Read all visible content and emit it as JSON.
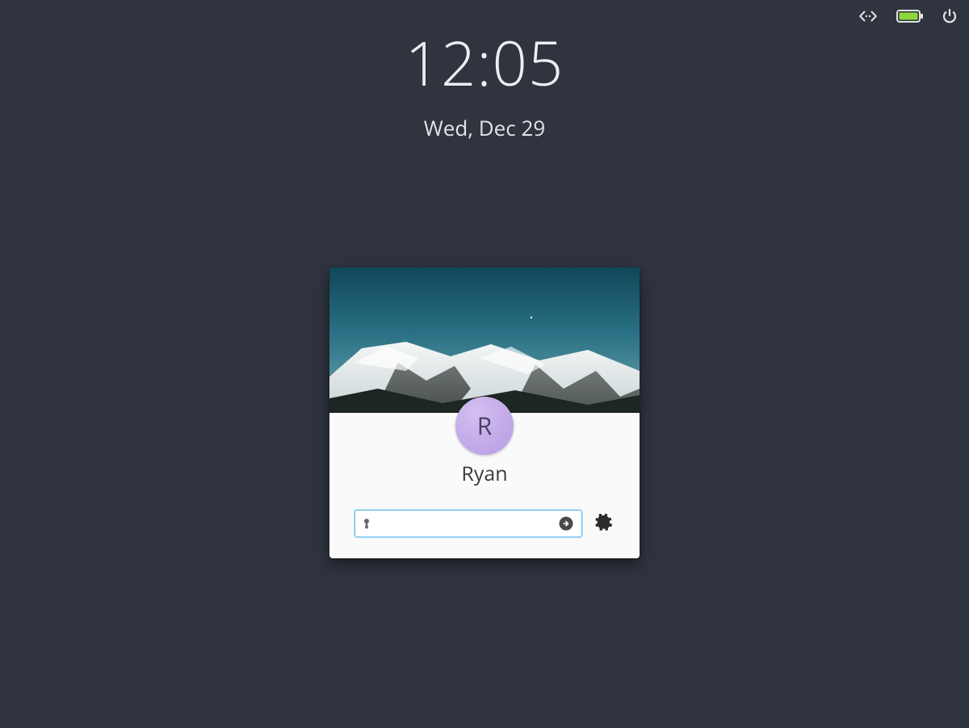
{
  "clock": {
    "time": "12:05",
    "date": "Wed, Dec 29"
  },
  "login": {
    "username": "Ryan",
    "avatar_letter": "R",
    "password_value": "",
    "password_placeholder": ""
  },
  "icons": {
    "network": "network-wired-icon",
    "battery": "battery-full-charging-icon",
    "power": "power-icon",
    "keyhole": "keyhole-icon",
    "submit": "arrow-right-circle-icon",
    "settings": "gear-icon"
  },
  "colors": {
    "bg": "#2f343f",
    "card": "#fafafa",
    "accent": "#64baed",
    "avatar": "#c6aeea",
    "battery_fill": "#8bd63b"
  }
}
